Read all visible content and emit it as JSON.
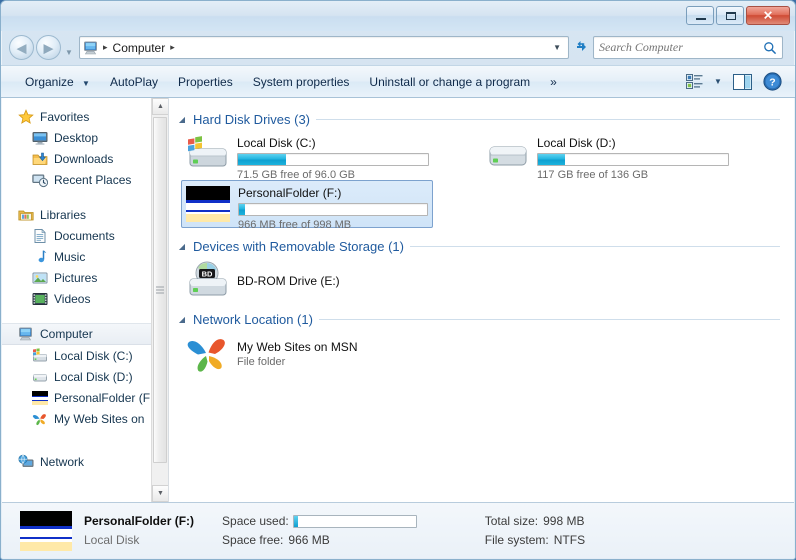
{
  "window": {
    "title": "Computer",
    "buttons": {
      "minimize": "Minimize",
      "maximize": "Maximize",
      "close": "Close",
      "close_glyph": "✕"
    }
  },
  "nav": {
    "back_label": "Back",
    "back_glyph": "◀",
    "forward_label": "Forward",
    "forward_glyph": "▶",
    "history_glyph": "▼",
    "refresh_glyph": "↻"
  },
  "address": {
    "icon": "computer-icon",
    "crumbs": [
      "Computer"
    ],
    "separator": "▸",
    "dropdown_glyph": "▼"
  },
  "search": {
    "placeholder": "Search Computer",
    "value": ""
  },
  "toolbar": {
    "items": [
      {
        "label": "Organize",
        "has_caret": true
      },
      {
        "label": "AutoPlay",
        "has_caret": false
      },
      {
        "label": "Properties",
        "has_caret": false
      },
      {
        "label": "System properties",
        "has_caret": false
      },
      {
        "label": "Uninstall or change a program",
        "has_caret": false
      },
      {
        "label": "»",
        "has_caret": false
      }
    ],
    "caret_glyph": "▼",
    "views_label": "Change your view",
    "preview_label": "Show the preview pane",
    "help_label": "Get help",
    "help_glyph": "?"
  },
  "sidebar": {
    "groups": [
      {
        "header": {
          "label": "Favorites",
          "icon": "star-icon"
        },
        "items": [
          {
            "label": "Desktop",
            "icon": "desktop-icon"
          },
          {
            "label": "Downloads",
            "icon": "downloads-icon"
          },
          {
            "label": "Recent Places",
            "icon": "recent-places-icon"
          }
        ]
      },
      {
        "header": {
          "label": "Libraries",
          "icon": "libraries-icon"
        },
        "items": [
          {
            "label": "Documents",
            "icon": "documents-icon"
          },
          {
            "label": "Music",
            "icon": "music-icon"
          },
          {
            "label": "Pictures",
            "icon": "pictures-icon"
          },
          {
            "label": "Videos",
            "icon": "videos-icon"
          }
        ]
      },
      {
        "header": {
          "label": "Computer",
          "icon": "computer-icon",
          "selected": true
        },
        "items": [
          {
            "label": "Local Disk (C:)",
            "icon": "windows-drive-icon"
          },
          {
            "label": "Local Disk (D:)",
            "icon": "drive-icon"
          },
          {
            "label": "PersonalFolder (F",
            "icon": "personalfolder-icon"
          },
          {
            "label": "My Web Sites on",
            "icon": "msn-butterfly-icon"
          }
        ]
      },
      {
        "header": {
          "label": "Network",
          "icon": "network-icon"
        },
        "items": []
      }
    ],
    "scroll": {
      "up_glyph": "▲",
      "down_glyph": "▼"
    }
  },
  "content": {
    "groups": [
      {
        "title": "Hard Disk Drives (3)",
        "triangle": "◢",
        "type": "drives",
        "items": [
          {
            "name": "Local Disk (C:)",
            "sub": "71.5 GB free of 96.0 GB",
            "icon": "windows-drive-icon",
            "used_percent": 25.5,
            "selected": false
          },
          {
            "name": "Local Disk (D:)",
            "sub": "117 GB free of 136 GB",
            "icon": "drive-icon",
            "used_percent": 14.0,
            "selected": false
          },
          {
            "name": "PersonalFolder (F:)",
            "sub": "966 MB free of 998 MB",
            "icon": "personalfolder-icon",
            "used_percent": 3.2,
            "selected": true
          }
        ]
      },
      {
        "title": "Devices with Removable Storage (1)",
        "triangle": "◢",
        "type": "simple",
        "items": [
          {
            "name": "BD-ROM Drive (E:)",
            "sub": "",
            "icon": "bd-rom-icon"
          }
        ]
      },
      {
        "title": "Network Location (1)",
        "triangle": "◢",
        "type": "simple",
        "items": [
          {
            "name": "My Web Sites on MSN",
            "sub": "File folder",
            "icon": "msn-butterfly-icon"
          }
        ]
      }
    ]
  },
  "status": {
    "icon": "personalfolder-icon",
    "name": "PersonalFolder (F:)",
    "type": "Local Disk",
    "space_used_label": "Space used:",
    "space_used_percent": 3.2,
    "space_free_label": "Space free:",
    "space_free_value": "966 MB",
    "total_size_label": "Total size:",
    "total_size_value": "998 MB",
    "file_system_label": "File system:",
    "file_system_value": "NTFS"
  },
  "colors": {
    "accent_blue": "#1f5a9e",
    "gauge_blue": "#0f9fd0",
    "selection_blue": "#cfe4f8",
    "close_red": "#cf4a34"
  }
}
